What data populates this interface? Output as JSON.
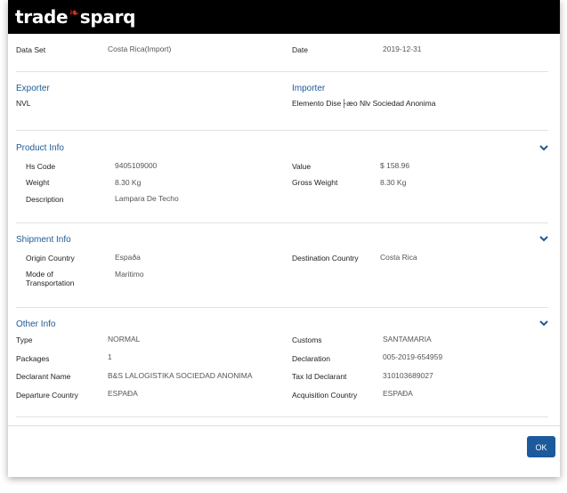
{
  "brand": {
    "part1": "trade",
    "part2": "sparq"
  },
  "top": {
    "dataset_label": "Data Set",
    "dataset_value": "Costa Rica(Import)",
    "date_label": "Date",
    "date_value": "2019-12-31"
  },
  "exporter": {
    "title": "Exporter",
    "value": "NVL"
  },
  "importer": {
    "title": "Importer",
    "value": "Elemento Dise├æo Nlv Sociedad Anonima"
  },
  "product": {
    "title": "Product Info",
    "hs_label": "Hs Code",
    "hs_value": "9405109000",
    "weight_label": "Weight",
    "weight_value": "8.30 Kg",
    "desc_label": "Description",
    "desc_value": "Lampara De Techo",
    "value_label": "Value",
    "value_value": "$ 158.96",
    "gross_label": "Gross Weight",
    "gross_value": "8.30 Kg"
  },
  "shipment": {
    "title": "Shipment Info",
    "origin_label": "Origin Country",
    "origin_value": "Espaða",
    "mode_label_1": "Mode of",
    "mode_label_2": "Transportation",
    "mode_value": "Maritimo",
    "dest_label": "Destination Country",
    "dest_value": "Costa Rica"
  },
  "other": {
    "title": "Other Info",
    "type_label": "Type",
    "type_value": "NORMAL",
    "packages_label": "Packages",
    "packages_value": "1",
    "declarant_label": "Declarant Name",
    "declarant_value": "B&S LALOGISTIKA SOCIEDAD ANONIMA",
    "departure_label": "Departure Country",
    "departure_value": "ESPAÐA",
    "customs_label": "Customs",
    "customs_value": "SANTAMARIA",
    "declaration_label": "Declaration",
    "declaration_value": "005-2019-654959",
    "taxid_label": "Tax Id Declarant",
    "taxid_value": "310103689027",
    "acq_label": "Acquisition Country",
    "acq_value": "ESPAÐA"
  },
  "footer": {
    "ok_label": "OK"
  },
  "colors": {
    "accent": "#1c5a9c",
    "section_title": "#1d5b96",
    "header_bg": "#000000"
  }
}
